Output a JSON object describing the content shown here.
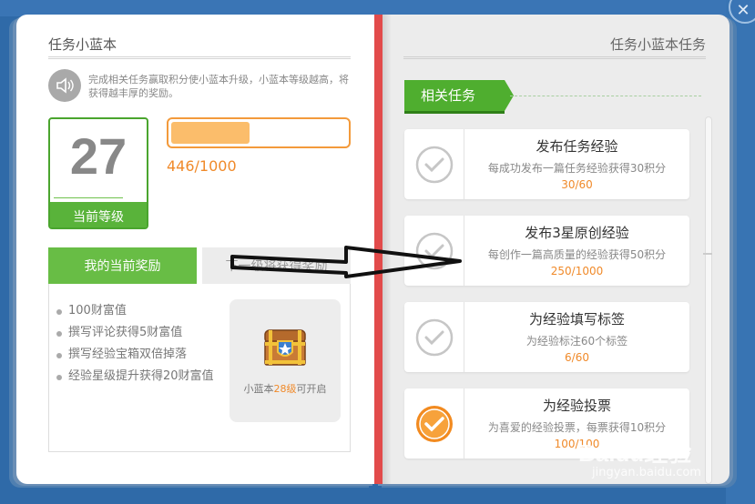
{
  "left": {
    "title": "任务小蓝本",
    "intro": "完成相关任务赢取积分使小蓝本升级，小蓝本等级越高，将获得越丰厚的奖励。",
    "level": {
      "value": "27",
      "label": "当前等级"
    },
    "progress": {
      "current": 446,
      "max": 1000,
      "text": "446/1000",
      "fraction": 0.446
    },
    "tabs": [
      {
        "label": "我的当前奖励",
        "active": true
      },
      {
        "label": "下一级将获得奖励",
        "active": false
      }
    ],
    "rewards": [
      "100财富值",
      "撰写评论获得5财富值",
      "撰写经验宝箱双倍掉落",
      "经验星级提升获得20财富值"
    ],
    "chest": {
      "prefix": "小蓝本",
      "level": "28级",
      "suffix": "可开启"
    }
  },
  "right": {
    "title": "任务小蓝本任务",
    "section_tag": "相关任务",
    "tasks": [
      {
        "name": "发布任务经验",
        "desc": "每成功发布一篇任务经验获得30积分",
        "progress": "30/60",
        "done": false
      },
      {
        "name": "发布3星原创经验",
        "desc": "每创作一篇高质量的经验获得50积分",
        "progress": "250/1000",
        "done": false
      },
      {
        "name": "为经验填写标签",
        "desc": "为经验标注60个标签",
        "progress": "6/60",
        "done": false
      },
      {
        "name": "为经验投票",
        "desc": "为喜爱的经验投票，每票获得10积分",
        "progress": "100/100",
        "done": true
      }
    ]
  },
  "watermark": {
    "brand": "Baidu经验",
    "url": "jingyan.baidu.com"
  },
  "colors": {
    "accent_green": "#59b33a",
    "accent_orange": "#f08a2a",
    "spine_red": "#e24b4b",
    "frame_blue": "#2f6aa8"
  },
  "icons": {
    "close": "close-icon",
    "speaker": "speaker-icon",
    "check": "check-icon",
    "chest": "treasure-chest-icon"
  }
}
